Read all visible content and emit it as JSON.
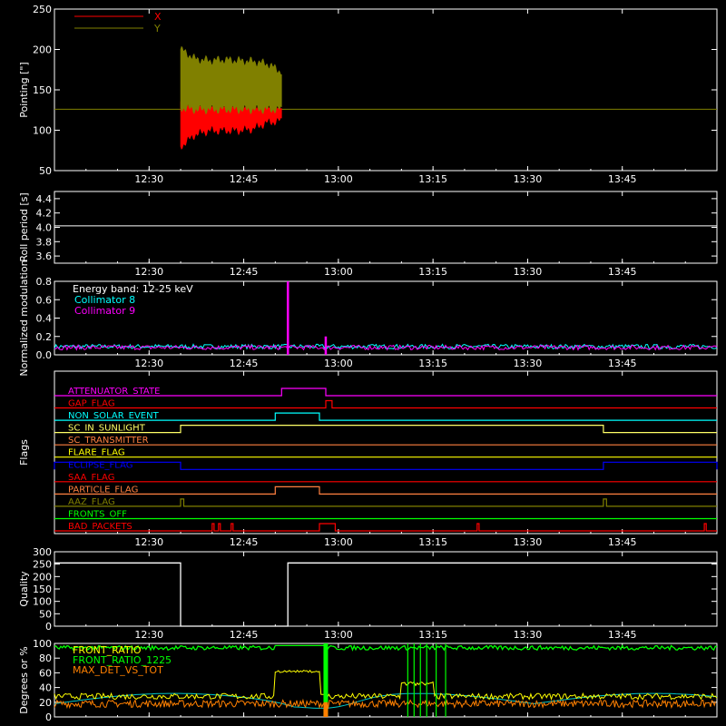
{
  "chart_data": [
    {
      "type": "line",
      "panel": "pointing",
      "ylabel": "Pointing [\"]",
      "ylim": [
        50,
        250
      ],
      "yticks": [
        50,
        100,
        150,
        200,
        250
      ],
      "xlim": [
        "12:15",
        "14:00"
      ],
      "xticks": [
        "12:30",
        "12:45",
        "13:00",
        "13:15",
        "13:30",
        "13:45"
      ],
      "legend_position": "top-left",
      "reference_level": 126,
      "series": [
        {
          "name": "X",
          "color": "#ff0000",
          "x_range": [
            "12:35",
            "12:51"
          ],
          "band_min": [
            80,
            95,
            100,
            100,
            100,
            102,
            110,
            112
          ],
          "band_max": [
            135,
            135,
            134,
            133,
            133,
            132,
            132,
            130
          ]
        },
        {
          "name": "Y",
          "color": "#808000",
          "x_range": [
            "12:35",
            "12:51"
          ],
          "band_min": [
            128,
            126,
            126,
            126,
            126,
            126,
            126,
            126
          ],
          "band_max": [
            200,
            188,
            186,
            187,
            186,
            185,
            182,
            172
          ]
        }
      ]
    },
    {
      "type": "line",
      "panel": "roll-period",
      "ylabel": "Roll period [s]",
      "ylim": [
        3.5,
        4.5
      ],
      "yticks": [
        3.6,
        3.8,
        4.0,
        4.2,
        4.4
      ],
      "series": [
        {
          "x": [
            "12:15",
            "14:00"
          ],
          "values": [
            4.02,
            4.02
          ],
          "color": "#ffffff"
        }
      ]
    },
    {
      "type": "line",
      "panel": "modulation",
      "ylabel": "Normalized modulation",
      "ylim": [
        0,
        0.8
      ],
      "yticks": [
        0.0,
        0.2,
        0.4,
        0.6,
        0.8
      ],
      "annotation": "Energy band: 12-25 keV",
      "series": [
        {
          "name": "Collimator 8",
          "color": "#00ffff",
          "baseline": 0.08
        },
        {
          "name": "Collimator 9",
          "color": "#ff00ff",
          "baseline": 0.07,
          "spikes": [
            {
              "x": "12:52",
              "value": 0.8
            },
            {
              "x": "12:58",
              "value": 0.2
            }
          ]
        }
      ]
    },
    {
      "type": "line",
      "panel": "flags",
      "ylabel": "Flags",
      "flags": [
        {
          "name": "ATTENUATOR_STATE",
          "color": "#ff00ff",
          "on": [
            [
              "12:51",
              "12:58"
            ]
          ]
        },
        {
          "name": "GAP_FLAG",
          "color": "#ff0000",
          "on": [
            [
              "12:58",
              "12:59"
            ]
          ]
        },
        {
          "name": "NON_SOLAR_EVENT",
          "color": "#00ffff",
          "on": [
            [
              "12:50",
              "12:57"
            ]
          ]
        },
        {
          "name": "SC_IN_SUNLIGHT",
          "color": "#ffff66",
          "on": [
            [
              "12:35",
              "13:42"
            ]
          ]
        },
        {
          "name": "SC_TRANSMITTER",
          "color": "#ff8040",
          "on": []
        },
        {
          "name": "FLARE_FLAG",
          "color": "#ffff00",
          "on": []
        },
        {
          "name": "ECLIPSE_FLAG",
          "color": "#0000ff",
          "on": [
            [
              "12:15",
              "12:35"
            ],
            [
              "13:42",
              "14:00"
            ]
          ]
        },
        {
          "name": "SAA_FLAG",
          "color": "#ff0000",
          "on": []
        },
        {
          "name": "PARTICLE_FLAG",
          "color": "#ff8040",
          "on": [
            [
              "12:50",
              "12:57"
            ]
          ]
        },
        {
          "name": "AAZ_FLAG",
          "color": "#808000",
          "on": [
            [
              "12:35",
              "12:35.5"
            ],
            [
              "13:42",
              "13:42.5"
            ]
          ]
        },
        {
          "name": "FRONTS_OFF",
          "color": "#00ff00",
          "on": []
        },
        {
          "name": "BAD_PACKETS",
          "color": "#ff0000",
          "on": [
            [
              "12:40",
              "12:40.3"
            ],
            [
              "12:41",
              "12:41.3"
            ],
            [
              "12:43",
              "12:43.3"
            ],
            [
              "12:57",
              "12:59.5"
            ],
            [
              "13:22",
              "13:22.3"
            ],
            [
              "13:58",
              "13:58.3"
            ]
          ]
        }
      ]
    },
    {
      "type": "line",
      "panel": "quality",
      "ylabel": "Quality",
      "ylim": [
        0,
        300
      ],
      "yticks": [
        0,
        50,
        100,
        150,
        200,
        250,
        300
      ],
      "series": [
        {
          "x": [
            "12:15",
            "12:35",
            "12:35",
            "12:52",
            "12:52",
            "14:00"
          ],
          "values": [
            255,
            255,
            0,
            0,
            255,
            255
          ],
          "color": "#ffffff"
        }
      ]
    },
    {
      "type": "line",
      "panel": "degrees",
      "ylabel": "Degrees or %",
      "ylim": [
        0,
        100
      ],
      "yticks": [
        0,
        20,
        40,
        60,
        80,
        100
      ],
      "series": [
        {
          "name": "FRONT_RATIO",
          "color": "#ffff00"
        },
        {
          "name": "FRONT_RATIO_1225",
          "color": "#00ff00"
        },
        {
          "name": "MAX_DET_VS_TOT",
          "color": "#ff8000"
        }
      ]
    }
  ]
}
